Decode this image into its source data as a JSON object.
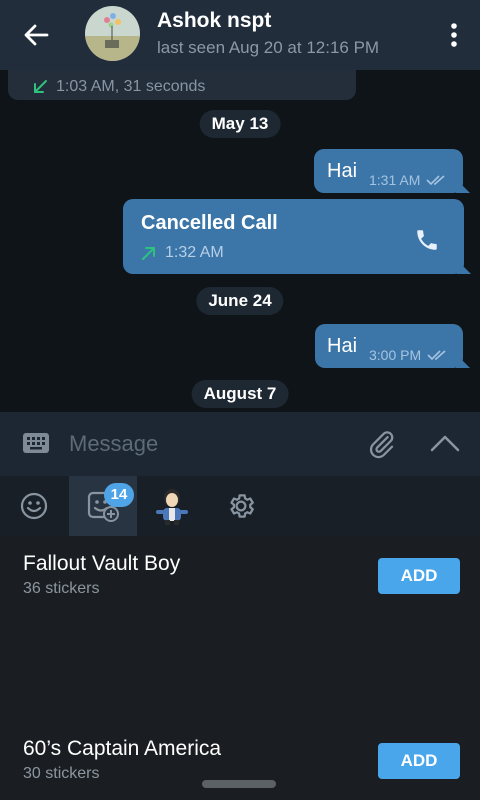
{
  "header": {
    "title": "Ashok nspt",
    "subtitle": "last seen Aug 20 at 12:16 PM"
  },
  "chat": {
    "partial_incoming": {
      "info": "1:03 AM, 31 seconds"
    },
    "dates": [
      "May 13",
      "June 24",
      "August 7"
    ],
    "messages": [
      {
        "text": "Hai",
        "time": "1:31 AM"
      },
      {
        "call_title": "Cancelled Call",
        "time": "1:32 AM"
      },
      {
        "text": "Hai",
        "time": "3:00 PM"
      }
    ]
  },
  "input": {
    "placeholder": "Message"
  },
  "sticker_tabs": {
    "badge": "14"
  },
  "sticker_packs": [
    {
      "title": "Fallout Vault Boy",
      "count": "36 stickers",
      "button": "ADD"
    },
    {
      "title": "60’s Captain America",
      "count": "30 stickers",
      "button": "ADD"
    }
  ],
  "colors": {
    "header_bg": "#212d3b",
    "outgoing_bubble": "#3c76a8",
    "accent": "#4aa6ea",
    "call_arrow_green": "#2ec27e"
  }
}
